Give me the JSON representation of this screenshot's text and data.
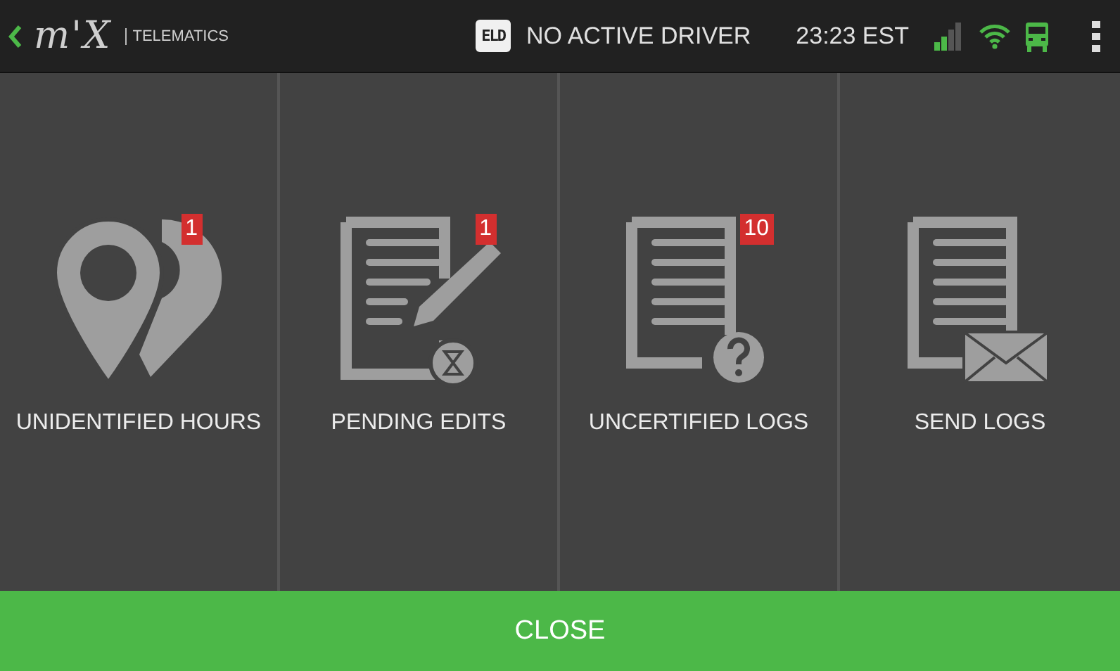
{
  "top_bar": {
    "logo": "m'X",
    "logo_subtitle": "TELEMATICS",
    "eld_badge": "ELD",
    "driver_status": "NO ACTIVE DRIVER",
    "time": "23:23 EST"
  },
  "tiles": [
    {
      "kind": "pins",
      "label": "UNIDENTIFIED HOURS",
      "badge": "1"
    },
    {
      "kind": "edit",
      "label": "PENDING EDITS",
      "badge": "1"
    },
    {
      "kind": "question",
      "label": "UNCERTIFIED LOGS",
      "badge": "10"
    },
    {
      "kind": "mail",
      "label": "SEND LOGS"
    }
  ],
  "close_button": "CLOSE"
}
